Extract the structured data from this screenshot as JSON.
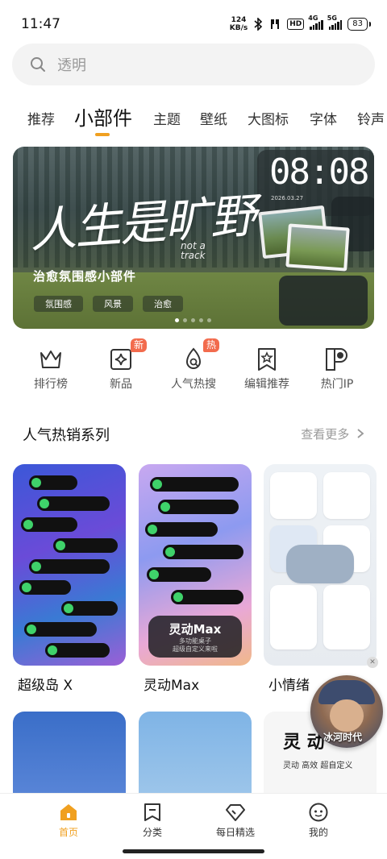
{
  "status_bar": {
    "time": "11:47",
    "net_speed_value": "124",
    "net_speed_unit": "KB/s",
    "hd_label": "HD",
    "sim1_label": "4G",
    "sim2_label": "5G",
    "battery": "83"
  },
  "search": {
    "placeholder": "透明",
    "icon": "search-icon"
  },
  "tabs": [
    {
      "label": "推荐"
    },
    {
      "label": "小部件",
      "active": true
    },
    {
      "label": "主题"
    },
    {
      "label": "壁纸"
    },
    {
      "label": "大图标"
    },
    {
      "label": "字体"
    },
    {
      "label": "铃声"
    }
  ],
  "banner": {
    "headline": "人生是旷野",
    "side_text": "not a track",
    "subtitle": "治愈氛围感小部件",
    "chips": [
      "氛围感",
      "风景",
      "治愈"
    ],
    "clock": "08:08",
    "clock_date": "2026.03.27",
    "page_count": 5,
    "active_page": 1
  },
  "categories": [
    {
      "label": "排行榜",
      "icon": "crown-icon"
    },
    {
      "label": "新品",
      "icon": "sparkle-icon",
      "badge": "新"
    },
    {
      "label": "人气热搜",
      "icon": "flame-search-icon",
      "badge": "热"
    },
    {
      "label": "编辑推荐",
      "icon": "star-bookmark-icon"
    },
    {
      "label": "热门IP",
      "icon": "ip-icon"
    }
  ],
  "section": {
    "title": "人气热销系列",
    "more": "查看更多"
  },
  "products": [
    {
      "name": "超级岛 X"
    },
    {
      "name": "灵动Max",
      "overlay_title": "灵动Max",
      "overlay_sub1": "多功能桌子",
      "overlay_sub2": "超级自定义来啦"
    },
    {
      "name": "小情绪"
    }
  ],
  "more_products": [
    {
      "title": ""
    },
    {
      "title": ""
    },
    {
      "title": "灵 动",
      "sub": "灵动 高效 超自定义"
    }
  ],
  "floating_ad": {
    "text": "冰河时代"
  },
  "bottom_nav": [
    {
      "label": "首页",
      "icon": "home-icon",
      "active": true
    },
    {
      "label": "分类",
      "icon": "category-icon"
    },
    {
      "label": "每日精选",
      "icon": "diamond-icon"
    },
    {
      "label": "我的",
      "icon": "profile-icon"
    }
  ],
  "colors": {
    "accent": "#f0a020",
    "badge": "#f26b4d"
  }
}
